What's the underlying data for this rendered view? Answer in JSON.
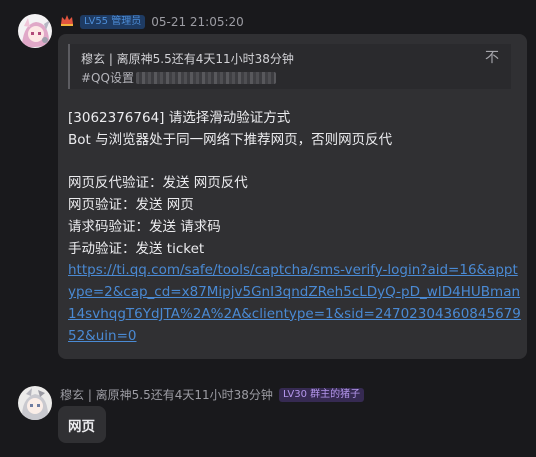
{
  "messages": [
    {
      "time": "05-21 21:05:20",
      "badge": "LV55 管理员",
      "quote": {
        "author": "穆玄 | 离原神5.5还有4天11小时38分钟",
        "text_prefix": "#QQ设置",
        "close_icon": "不"
      },
      "body": {
        "line1": "[3062376764] 请选择滑动验证方式",
        "line2": "Bot 与浏览器处于同一网络下推荐网页，否则网页反代",
        "line3": "网页反代验证：发送 网页反代",
        "line4": "网页验证：发送 网页",
        "line5": "请求码验证：发送 请求码",
        "line6": "手动验证：发送 ticket",
        "link": "https://ti.qq.com/safe/tools/captcha/sms-verify-login?aid=16&apptype=2&cap_cd=x87Mipjv5GnI3qndZReh5cLDyQ-pD_wID4HUBman14svhqgT6YdJTA%2A%2A&clientype=1&sid=2470230436084567952&uin=0"
      }
    },
    {
      "sender": "穆玄 | 离原神5.5还有4天11小时38分钟",
      "badge": "LV30 群主的猪子",
      "text": "网页"
    }
  ],
  "colors": {
    "background": "#19191c",
    "bubble": "#303033",
    "link": "#4a8ad4",
    "badge_blue": "#4d8ed8",
    "badge_purple": "#b496ec"
  },
  "icons": [
    "avatar-anime-pink-hair",
    "crown-icon",
    "avatar-anime-white-hair"
  ]
}
